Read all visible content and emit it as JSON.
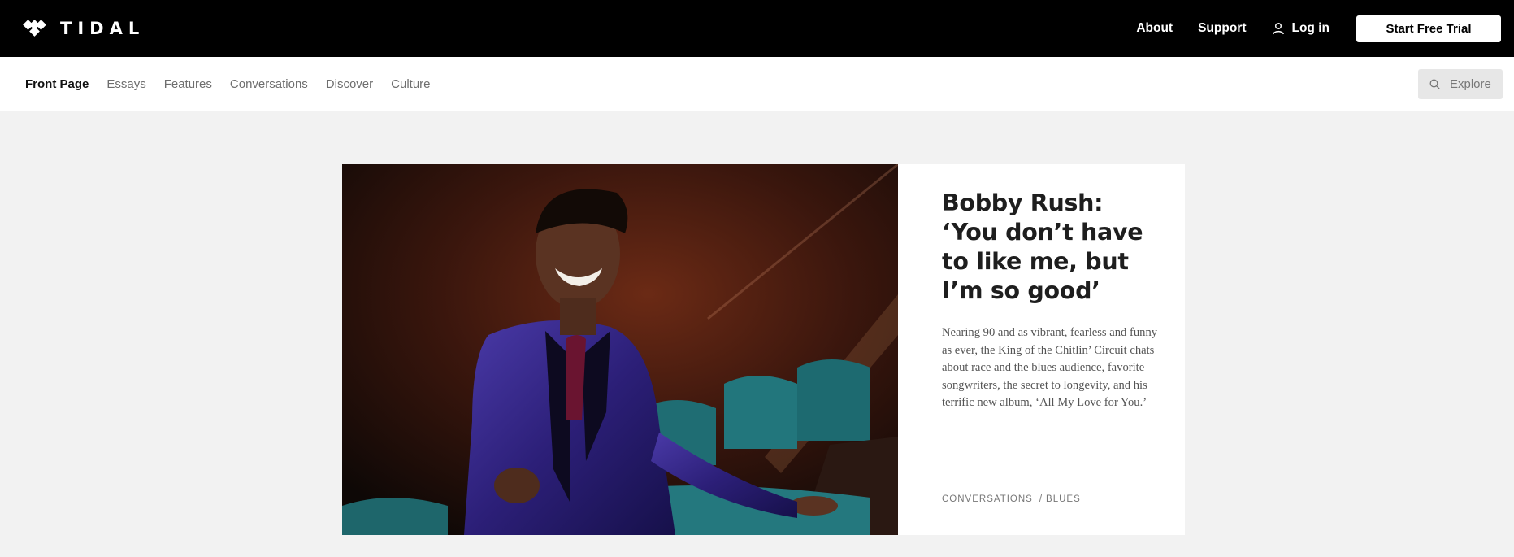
{
  "header": {
    "logo_text": "TIDAL",
    "links": [
      "About",
      "Support"
    ],
    "login_label": "Log in",
    "trial_label": "Start Free Trial"
  },
  "subnav": {
    "items": [
      "Front Page",
      "Essays",
      "Features",
      "Conversations",
      "Discover",
      "Culture"
    ],
    "active": "Front Page",
    "explore_label": "Explore"
  },
  "feature": {
    "headline": "Bobby Rush: ‘You don’t have to like me, but I’m so good’",
    "summary": "Nearing 90 and as vibrant, fearless and funny as ever, the King of the Chitlin’ Circuit chats about race and the blues audience, favorite songwriters, the secret to longevity, and his terrific new album, ‘All My Love for You.’",
    "tags": [
      "CONVERSATIONS",
      "BLUES"
    ],
    "tag_separator": "/"
  },
  "colors": {
    "header_bg": "#000000",
    "page_bg": "#f2f2f2",
    "card_bg": "#ffffff",
    "explore_bg": "#e7e7e7"
  },
  "icons": {
    "logo": "tidal-logo-icon",
    "user": "user-icon",
    "search": "search-icon"
  }
}
